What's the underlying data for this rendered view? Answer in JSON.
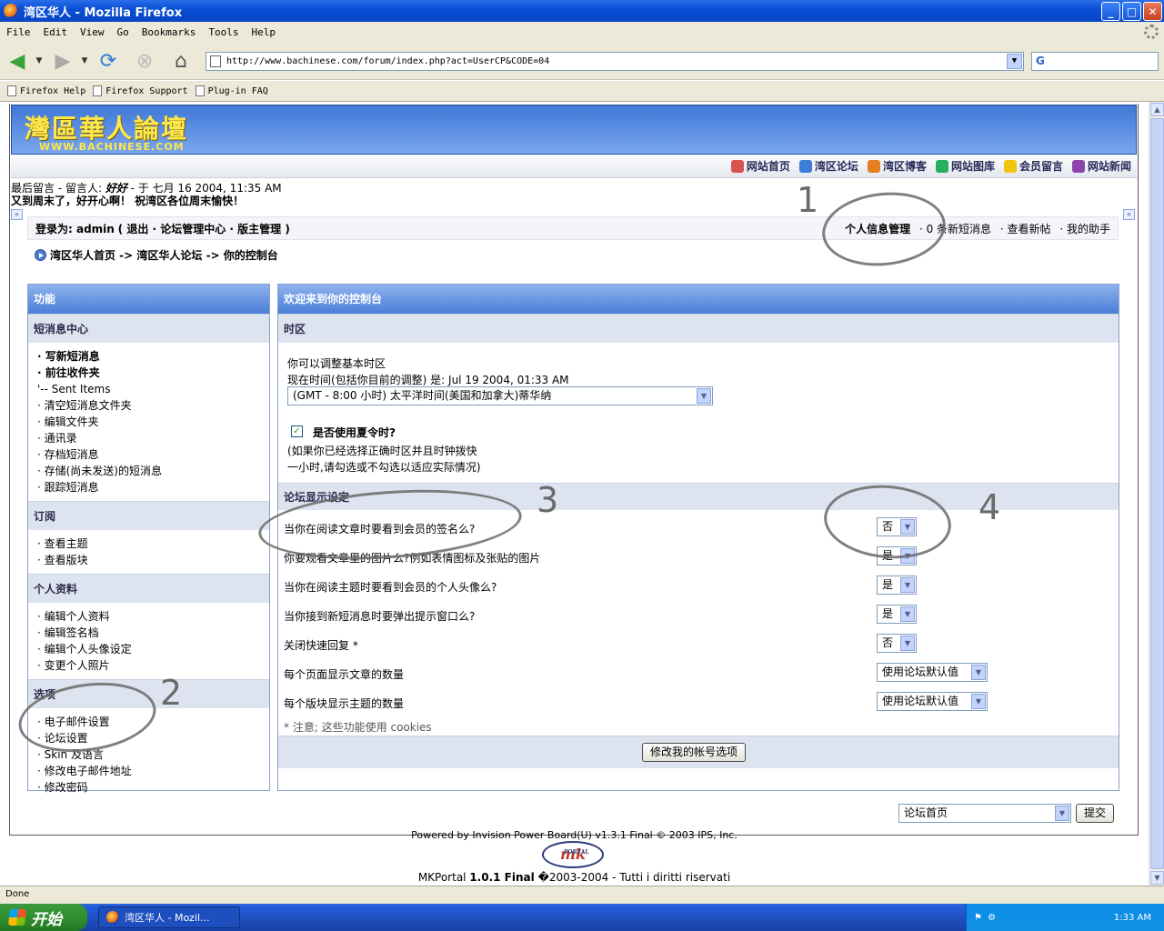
{
  "window": {
    "title": "湾区华人 - Mozilla Firefox",
    "min": "_",
    "max": "□",
    "close": "✕"
  },
  "menu": [
    "File",
    "Edit",
    "View",
    "Go",
    "Bookmarks",
    "Tools",
    "Help"
  ],
  "nav": {
    "url": "http://www.bachinese.com/forum/index.php?act=UserCP&CODE=04",
    "search_logo": "G"
  },
  "bookmarks": [
    "Firefox Help",
    "Firefox Support",
    "Plug-in FAQ"
  ],
  "site": {
    "logo_cn": "灣區華人論壇",
    "logo_en": "WWW.BACHINESE.COM",
    "topnav": [
      "网站首页",
      "湾区论坛",
      "湾区博客",
      "网站图库",
      "会员留言",
      "网站新闻"
    ],
    "topnav_colors": [
      "#d9534f",
      "#3b7dd8",
      "#e67e22",
      "#27ae60",
      "#f1c40f",
      "#8e44ad"
    ],
    "last_msg_prefix": "最后留言 - 留言人: ",
    "last_msg_author": "好好",
    "last_msg_time": " - 于 七月 16 2004, 11:35 AM",
    "last_msg_text": "又到周末了，好开心啊！ 祝湾区各位周末愉快！",
    "arrow": "»",
    "arrow_right": "«"
  },
  "userbar": {
    "logged_in_as": "登录为: ",
    "user": "admin",
    "links": "( 退出 · 论坛管理中心 · 版主管理 )",
    "profile": "个人信息管理",
    "new_msgs": "· 0 条新短消息",
    "new_posts": "· 查看新帖",
    "assistant": "· 我的助手"
  },
  "breadcrumb": "湾区华人首页 -> 湾区华人论坛 -> 你的控制台",
  "left": {
    "header": "功能",
    "sections": [
      {
        "title": "短消息中心",
        "items": [
          "· 写新短消息",
          "· 前往收件夹",
          "'-- Sent Items",
          "· 清空短消息文件夹",
          "· 编辑文件夹",
          "· 通讯录",
          "· 存档短消息",
          "· 存储(尚未发送)的短消息",
          "· 跟踪短消息"
        ]
      },
      {
        "title": "订阅",
        "items": [
          "· 查看主题",
          "· 查看版块"
        ]
      },
      {
        "title": "个人资料",
        "items": [
          "· 编辑个人资料",
          "· 编辑签名档",
          "· 编辑个人头像设定",
          "· 变更个人照片"
        ]
      },
      {
        "title": "选项",
        "items": [
          "· 电子邮件设置",
          "· 论坛设置",
          "· Skin 及语言",
          "· 修改电子邮件地址",
          "· 修改密码"
        ]
      }
    ]
  },
  "right": {
    "header": "欢迎来到你的控制台",
    "tz_title": "时区",
    "tz_line1": "你可以调整基本时区",
    "tz_line2": "现在时间(包括你目前的调整) 是:  Jul 19 2004, 01:33 AM",
    "tz_select": "(GMT - 8:00 小时) 太平洋时间(美国和加拿大)蒂华纳",
    "dst_label": "是否使用夏令时?",
    "dst_checked": "✓",
    "dst_note1": "(如果你已经选择正确时区并且时钟拨快",
    "dst_note2": "一小时,请勾选或不勾选以适应实际情况)",
    "display_title": "论坛显示设定",
    "settings": [
      {
        "label": "当你在阅读文章时要看到会员的签名么?",
        "value": "否"
      },
      {
        "label": "你要观看文章里的图片么?例如表情图标及张贴的图片",
        "value": "是"
      },
      {
        "label": "当你在阅读主题时要看到会员的个人头像么?",
        "value": "是"
      },
      {
        "label": "当你接到新短消息时要弹出提示窗口么?",
        "value": "是"
      },
      {
        "label": "关闭快速回复 *",
        "value": "否"
      },
      {
        "label": "每个页面显示文章的数量",
        "value": "使用论坛默认值"
      },
      {
        "label": "每个版块显示主题的数量",
        "value": "使用论坛默认值"
      }
    ],
    "note": "* 注意; 这些功能使用 cookies",
    "submit": "修改我的帐号选项"
  },
  "footer": {
    "jump_select": "论坛首页",
    "jump_btn": "提交",
    "powered": "Powered by Invision Power Board(U) v1.3.1 Final © 2003  IPS, Inc.",
    "mk_logo": "mk",
    "mk_portal": "PORTAL",
    "copyright_a": "MKPortal ",
    "copyright_b": "1.0.1 Final",
    "copyright_c": " �2003-2004 - Tutti i diritti riservati"
  },
  "annotations": [
    "1",
    "2",
    "3",
    "4"
  ],
  "status": "Done",
  "taskbar": {
    "start": "开始",
    "item": "湾区华人 - Mozil...",
    "ch": "CH",
    "clock": "1:33 AM"
  }
}
